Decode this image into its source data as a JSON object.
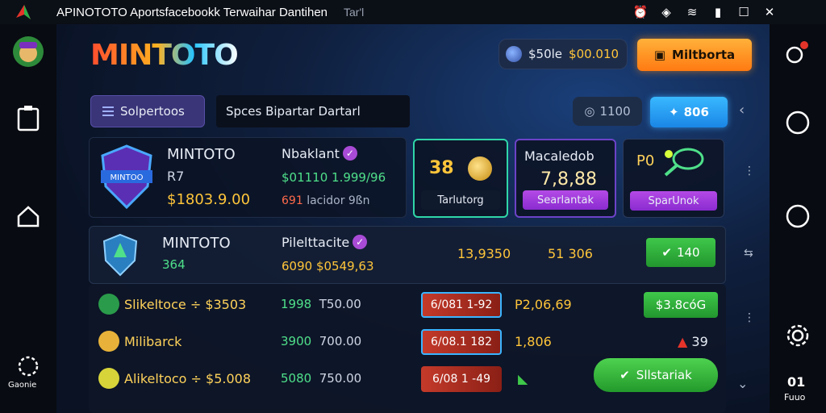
{
  "titlebar": {
    "title": "APINOTOTO Aportsfacebookk Terwaihar Dantihen",
    "tab": "Tar'l"
  },
  "left_nav": {
    "bottom_label": "Gaonie"
  },
  "right_nav": {
    "bottom_label": "Fuuo",
    "bottom_number": "01"
  },
  "header": {
    "brand": "MINTOTO",
    "balance_label": "$50le",
    "balance_value": "$00.010",
    "cta_label": "Miltborta"
  },
  "toolbar": {
    "filter_label": "Solpertoos",
    "search_placeholder": "Spces Bipartar Dartarl",
    "stat_value": "1100",
    "stat_active_value": "806"
  },
  "hero": {
    "name": "MINTOTO",
    "rank": "R7",
    "money": "$1803.9.00",
    "bonus_title": "Nbaklant",
    "bonus_line": "$01110 1.999/96",
    "bonus_foot_red": "691",
    "bonus_foot_rest": "lacidor 9ßn"
  },
  "cards": [
    {
      "big": "38",
      "foot": "Tarlutorg"
    },
    {
      "head": "Macaledob",
      "number": "7,8,88",
      "foot": "Searlantak"
    },
    {
      "head": "P0",
      "foot": "SparUnok"
    }
  ],
  "featured": {
    "name": "MINTOTO",
    "sub": "364",
    "heading": "Pilelttacite",
    "odds": "6090 $0549,63",
    "col1": "13,9350",
    "col2": "51 306",
    "btn": "140"
  },
  "rows": [
    {
      "name": "Slikeltoce ÷ $3503",
      "mid_green": "1998",
      "mid_gray": "T50.00",
      "pill": "6/081 1-92",
      "val": "P2,06,69",
      "action": "$3.8cóG"
    },
    {
      "name": "Milibarck",
      "mid_green": "3900",
      "mid_gray": "700.00",
      "pill": "6/08.1 182",
      "val": "1,806",
      "alert": "39"
    },
    {
      "name": "Alikeltoco ÷ $5.008",
      "mid_green": "5080",
      "mid_gray": "750.00",
      "pill": "6/08 1 -49"
    }
  ],
  "cta_bottom": "Sllstariak",
  "colors": {
    "accent": "#ffc53a",
    "green": "#3fc84a",
    "purple": "#a94bd6",
    "blue": "#39b8ff"
  }
}
